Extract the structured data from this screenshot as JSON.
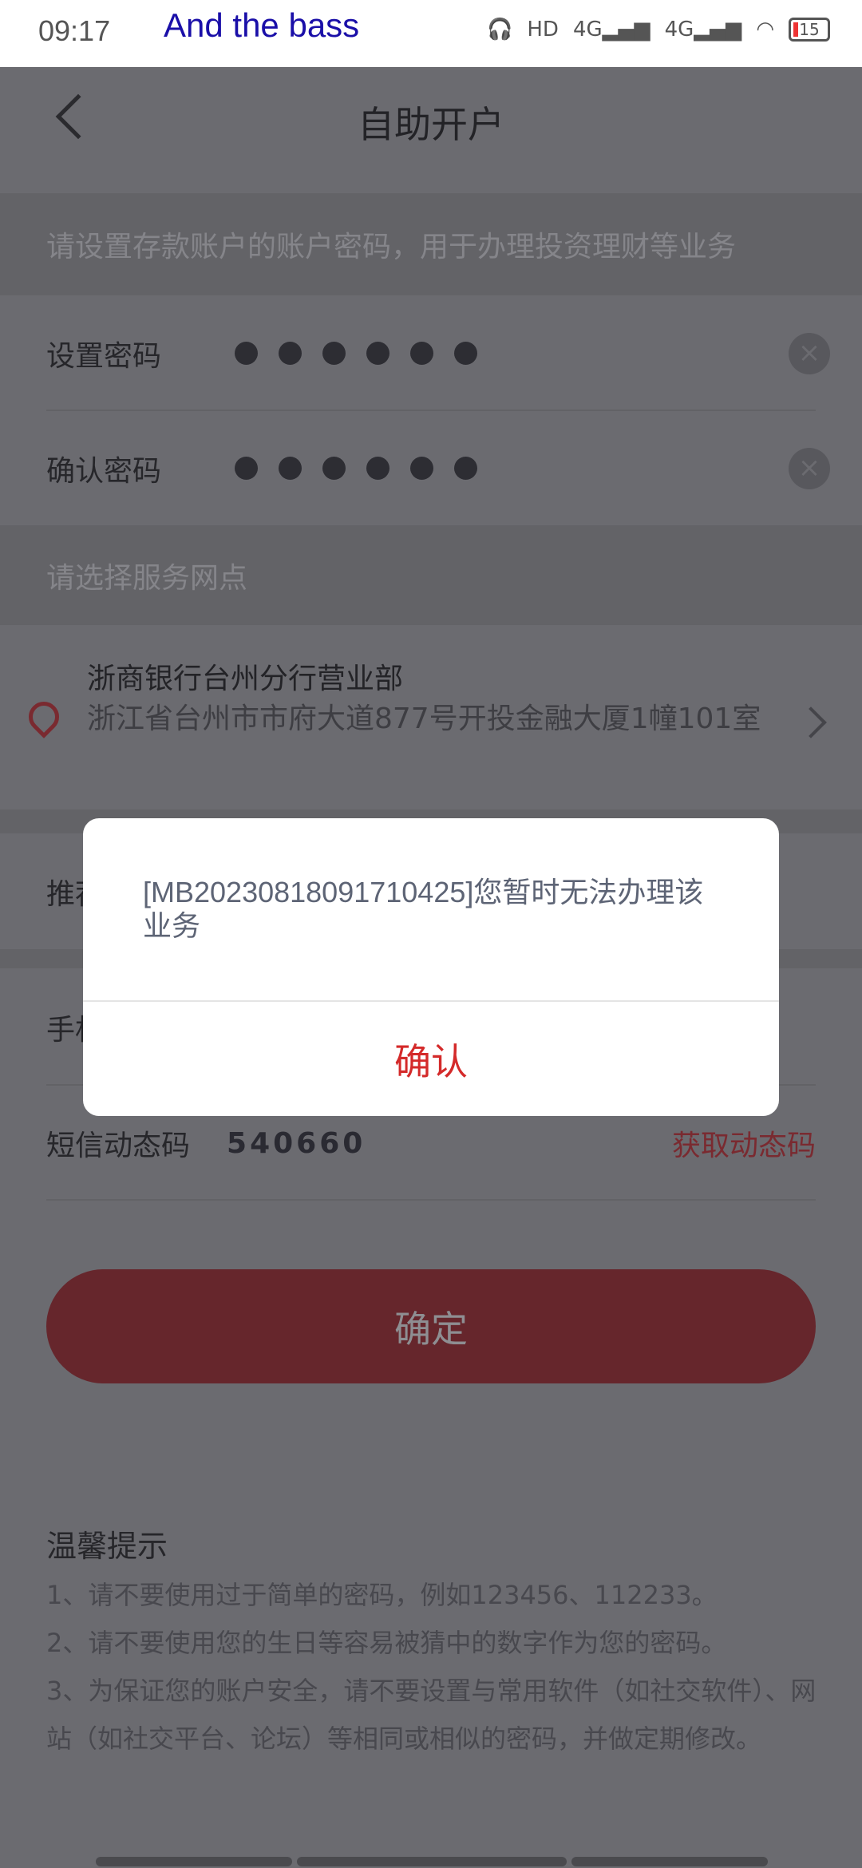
{
  "status_bar": {
    "time": "09:17",
    "ticker": "And the  bass",
    "battery": "15",
    "icons": [
      "alarm-icon",
      "app-icon",
      "notification-icon",
      "headphones-icon",
      "hd-icon",
      "signal-4g-icon",
      "signal-4g-icon",
      "wifi-icon",
      "battery-icon"
    ]
  },
  "header": {
    "title": "自助开户",
    "back_icon": "chevron-left-icon"
  },
  "form": {
    "hint": "请设置存款账户的账户密码，用于办理投资理财等业务",
    "set_password_label": "设置密码",
    "confirm_password_label": "确认密码",
    "branch_section": "请选择服务网点",
    "branch_name": "浙商银行台州分行营业部",
    "branch_address": "浙江省台州市市府大道877号开投金融大厦1幢101室",
    "referrer_label": "推荐人",
    "phone_label": "手机号",
    "sms_label": "短信动态码",
    "sms_code": "540660",
    "get_code": "获取动态码",
    "submit": "确定"
  },
  "tips": {
    "title": "温馨提示",
    "items": [
      "1、请不要使用过于简单的密码，例如123456、112233。",
      "2、请不要使用您的生日等容易被猜中的数字作为您的密码。",
      "3、为保证您的账户安全，请不要设置与常用软件（如社交软件）、网站（如社交平台、论坛）等相同或相似的密码，并做定期修改。"
    ]
  },
  "dialog": {
    "message": "[MB20230818091710425]您暂时无法办理该业务",
    "confirm": "确认"
  },
  "colors": {
    "accent": "#c0202a",
    "button": "#e93c46",
    "dialog_confirm": "#d42a2a"
  }
}
